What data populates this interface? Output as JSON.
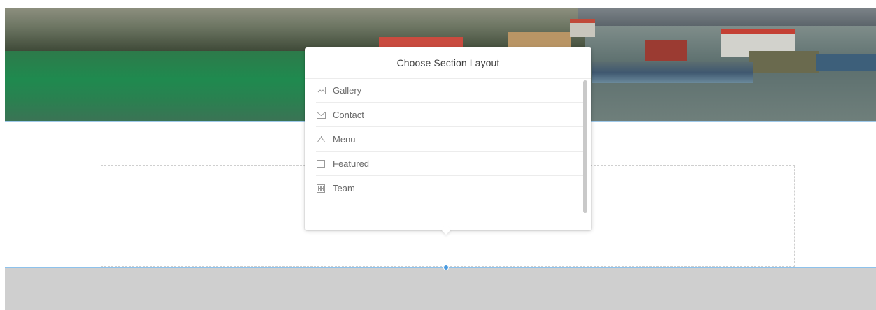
{
  "popover": {
    "title": "Choose Section Layout",
    "options": [
      {
        "label": "Gallery",
        "icon": "image-icon"
      },
      {
        "label": "Contact",
        "icon": "envelope-icon"
      },
      {
        "label": "Menu",
        "icon": "cloche-icon"
      },
      {
        "label": "Featured",
        "icon": "square-icon"
      },
      {
        "label": "Team",
        "icon": "team-grid-icon"
      }
    ]
  },
  "colors": {
    "accent_line": "#8ec2ec",
    "handle": "#4a9be0",
    "gray_band": "#cfcfcf"
  }
}
